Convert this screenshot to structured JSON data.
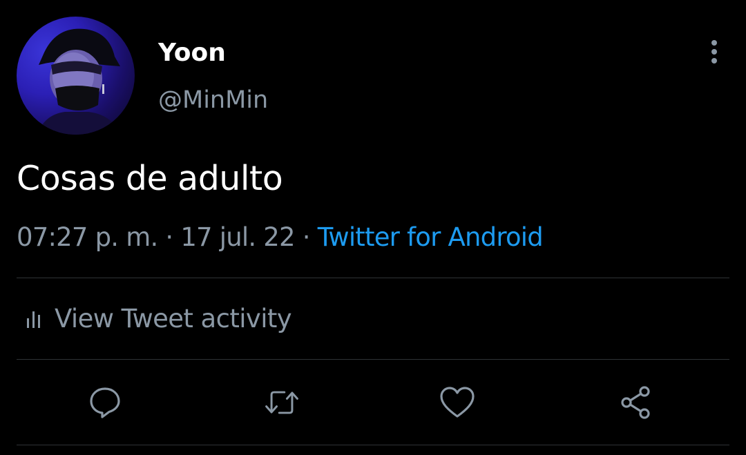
{
  "tweet": {
    "author": {
      "display_name": "Yoon",
      "handle": "@MinMin",
      "avatar_icon": "profile-photo"
    },
    "text": "Cosas de adulto",
    "meta": {
      "time": "07:27 p. m.",
      "separator": "·",
      "date": "17 jul. 22",
      "source": "Twitter for Android"
    },
    "activity": {
      "icon": "bar-chart-icon",
      "label": "View Tweet activity"
    },
    "actions": [
      {
        "icon": "reply-icon"
      },
      {
        "icon": "retweet-icon"
      },
      {
        "icon": "like-icon"
      },
      {
        "icon": "share-icon"
      }
    ],
    "more_icon": "more-vertical-icon"
  },
  "colors": {
    "background": "#000000",
    "primary_text": "#ffffff",
    "secondary_text": "#8b98a5",
    "link": "#1d9bf0",
    "divider": "#2f3336"
  }
}
